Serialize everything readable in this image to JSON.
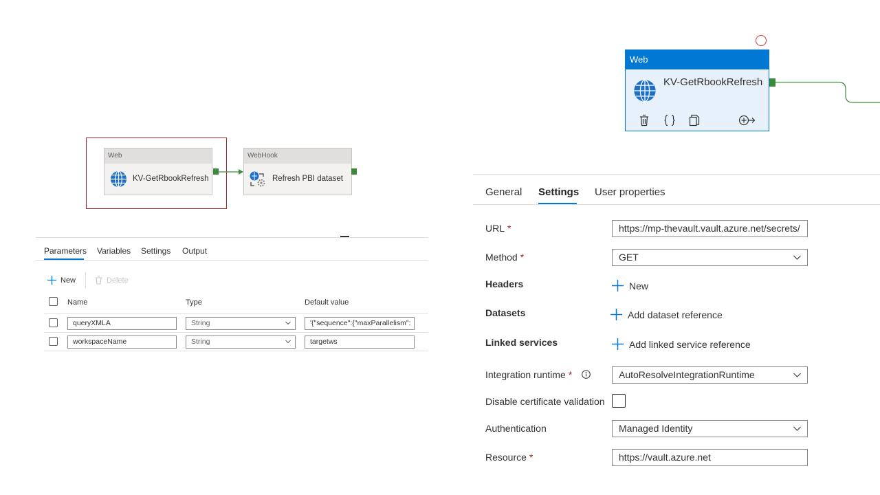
{
  "left_canvas": {
    "web_activity": {
      "type": "Web",
      "name": "KV-GetRbookRefresh"
    },
    "webhook_activity": {
      "type": "WebHook",
      "name": "Refresh PBI dataset"
    }
  },
  "left_panel": {
    "tabs": [
      "Parameters",
      "Variables",
      "Settings",
      "Output"
    ],
    "active_tab": "Parameters",
    "toolbar": {
      "new_label": "New",
      "delete_label": "Delete"
    },
    "columns": {
      "name": "Name",
      "type": "Type",
      "default": "Default value"
    },
    "rows": [
      {
        "name": "queryXMLA",
        "type": "String",
        "default": "'{\"sequence\":{\"maxParallelism\":"
      },
      {
        "name": "workspaceName",
        "type": "String",
        "default": "targetws"
      }
    ]
  },
  "right_canvas": {
    "activity": {
      "type": "Web",
      "name": "KV-GetRbookRefresh"
    }
  },
  "right_panel": {
    "tabs": [
      "General",
      "Settings",
      "User properties"
    ],
    "active_tab": "Settings",
    "url": {
      "label": "URL",
      "required_mark": "*",
      "value": "https://mp-thevault.vault.azure.net/secrets/"
    },
    "method": {
      "label": "Method",
      "required_mark": "*",
      "value": "GET"
    },
    "headers": {
      "label": "Headers",
      "action": "New"
    },
    "datasets": {
      "label": "Datasets",
      "action": "Add dataset reference"
    },
    "linked_services": {
      "label": "Linked services",
      "action": "Add linked service reference"
    },
    "integration_runtime": {
      "label": "Integration runtime",
      "required_mark": "*",
      "value": "AutoResolveIntegrationRuntime"
    },
    "disable_cert": {
      "label": "Disable certificate validation",
      "checked": false
    },
    "authentication": {
      "label": "Authentication",
      "value": "Managed Identity"
    },
    "resource": {
      "label": "Resource",
      "required_mark": "*",
      "value": "https://vault.azure.net"
    }
  },
  "colors": {
    "accent": "#0078d4",
    "required": "#a4262c",
    "port_green": "#3c8b3c",
    "selection_red": "#a4262c",
    "error_circle": "#d13438"
  },
  "icons": [
    "globe-icon",
    "webhook-icon",
    "plus-icon",
    "trash-icon",
    "braces-icon",
    "copy-icon",
    "add-output-icon",
    "info-icon",
    "chevron-down-icon"
  ]
}
